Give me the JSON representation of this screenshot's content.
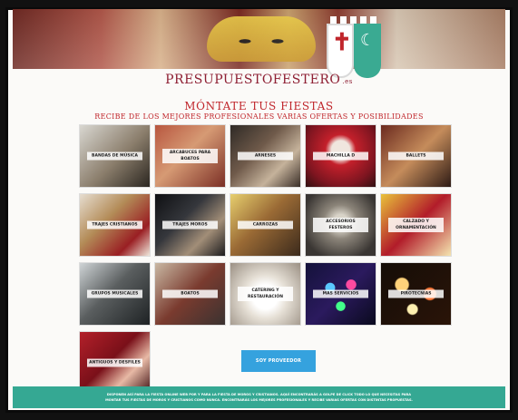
{
  "brand": {
    "logo_text": "PRESUPUESTOFESTERO",
    "logo_suffix": ".es"
  },
  "headline": "MÓNTATE TUS FIESTAS",
  "subline": "RECIBE DE LOS MEJORES PROFESIONALES VARIAS OFERTAS Y POSIBILIDADES",
  "icons": {
    "hero": "festival-mask-photo",
    "shield": "cross-and-crescent-shield-icon"
  },
  "categories": [
    {
      "label": "BANDAS DE MÚSICA"
    },
    {
      "label": "ARCABUCES PARA BOATOS"
    },
    {
      "label": "ARNESES"
    },
    {
      "label": "MACHILLA D"
    },
    {
      "label": "BALLETS"
    },
    {
      "label": "TRAJES CRISTIANOS"
    },
    {
      "label": "TRAJES MOROS"
    },
    {
      "label": "CARROZAS"
    },
    {
      "label": "ACCESORIOS FESTEROS"
    },
    {
      "label": "CALZADO Y ORNAMENTACIÓN"
    },
    {
      "label": "GRUPOS MUSICALES"
    },
    {
      "label": "BOATOS"
    },
    {
      "label": "CATERING Y RESTAURACIÓN"
    },
    {
      "label": "MAS SERVICIOS"
    },
    {
      "label": "PIROTECNIAS"
    },
    {
      "label": "ANTIGUOS Y DESFILES"
    }
  ],
  "cta_label": "SOY PROVEEDOR",
  "footer": {
    "line1": "DISPONEN ASÍ PARA LA FIESTA ONLINE WEB POR Y PARA LA FIESTA DE MOROS Y CRISTIANOS. AQUÍ ENCONTRARÁS A GOLPE DE CLICK TODO LO QUE NECESITAS PARA",
    "line2": "MONTAR TUS FIESTAS DE MOROS Y CRISTIANOS COMO NUNCA. ENCONTRARÁS LOS MEJORES PROFESIONALES Y RECIBE VARIAS OFERTAS CON DISTINTAS PROPUESTAS."
  },
  "colors": {
    "brand_red": "#c0262c",
    "footer_green": "#35a893",
    "cta_blue": "#35a2de"
  }
}
